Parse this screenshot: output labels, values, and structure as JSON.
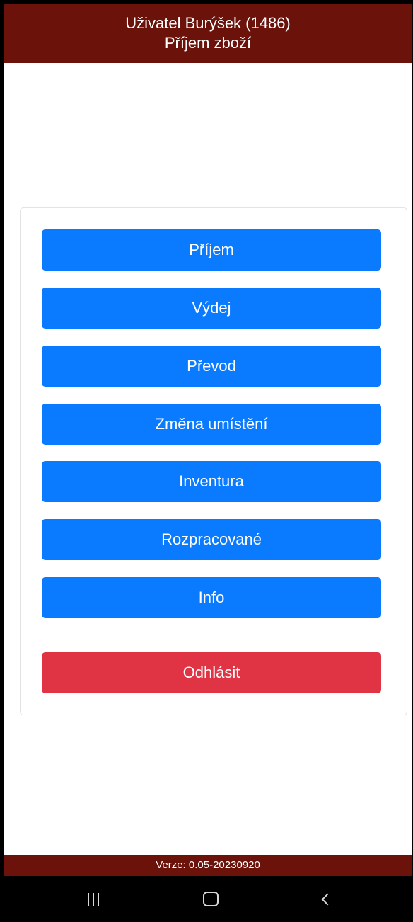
{
  "header": {
    "user_line": "Uživatel Burýšek (1486)",
    "screen_title": "Příjem zboží"
  },
  "menu": {
    "items": [
      {
        "label": "Příjem"
      },
      {
        "label": "Výdej"
      },
      {
        "label": "Převod"
      },
      {
        "label": "Změna umístění"
      },
      {
        "label": "Inventura"
      },
      {
        "label": "Rozpracované"
      },
      {
        "label": "Info"
      }
    ],
    "logout_label": "Odhlásit"
  },
  "footer": {
    "version": "Verze: 0.05-20230920"
  },
  "navbar": {
    "icons": [
      "recent-apps-icon",
      "home-icon",
      "back-icon"
    ]
  },
  "colors": {
    "header_bg": "#6b130b",
    "primary_button": "#0a7aff",
    "danger_button": "#e03445",
    "navbar_bg": "#000000"
  }
}
